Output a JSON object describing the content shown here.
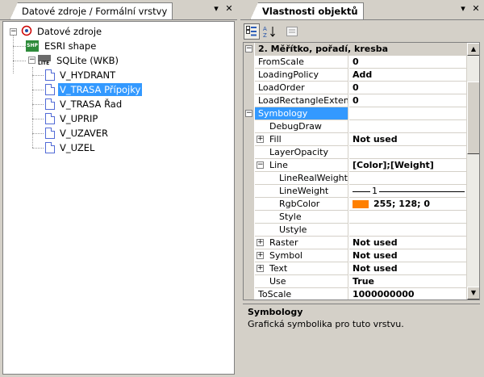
{
  "left_panel": {
    "tab_title": "Datové zdroje / Formální vrstvy",
    "pin_glyph": "▾",
    "close_glyph": "✕",
    "tree": {
      "root": "Datové zdroje",
      "children": [
        {
          "label": "ESRI shape",
          "icon": "shapefile-icon",
          "badge": "SHP"
        },
        {
          "label": "SQLite (WKB)",
          "icon": "sqlite-icon",
          "badge": "LITE",
          "layers": [
            "V_HYDRANT",
            "V_TRASA Přípojky",
            "V_TRASA Řad",
            "V_UPRIP",
            "V_UZAVER",
            "V_UZEL"
          ]
        }
      ]
    },
    "selected_layer": "V_TRASA Přípojky"
  },
  "right_panel": {
    "tab_title": "Vlastnosti objektů",
    "pin_glyph": "▾",
    "close_glyph": "✕",
    "toolbar": {
      "categorized_icon": "categorized-icon",
      "alphabetical_icon": "sort-az-icon",
      "pages_icon": "property-pages-icon"
    },
    "grid": {
      "category": "2. Měřítko, pořadí, kresba",
      "rows": [
        {
          "name": "FromScale",
          "value": "0"
        },
        {
          "name": "LoadingPolicy",
          "value": "Add"
        },
        {
          "name": "LoadOrder",
          "value": "0"
        },
        {
          "name": "LoadRectangleExtent",
          "value": "0"
        },
        {
          "name": "Symbology",
          "value": ""
        },
        {
          "name": "DebugDraw",
          "value": ""
        },
        {
          "name": "Fill",
          "value": "Not used"
        },
        {
          "name": "LayerOpacity",
          "value": ""
        },
        {
          "name": "Line",
          "value": "[Color];[Weight]"
        },
        {
          "name": "LineRealWeight",
          "value": ""
        },
        {
          "name": "LineWeight",
          "value": "1"
        },
        {
          "name": "RgbColor",
          "value": "255; 128; 0"
        },
        {
          "name": "Style",
          "value": ""
        },
        {
          "name": "Ustyle",
          "value": ""
        },
        {
          "name": "Raster",
          "value": "Not used"
        },
        {
          "name": "Symbol",
          "value": "Not used"
        },
        {
          "name": "Text",
          "value": "Not used"
        },
        {
          "name": "Use",
          "value": "True"
        },
        {
          "name": "ToScale",
          "value": "1000000000"
        }
      ],
      "swatch_color": "#ff8000"
    },
    "description": {
      "title": "Symbology",
      "text": "Grafická symbolika pro tuto vrstvu."
    }
  }
}
